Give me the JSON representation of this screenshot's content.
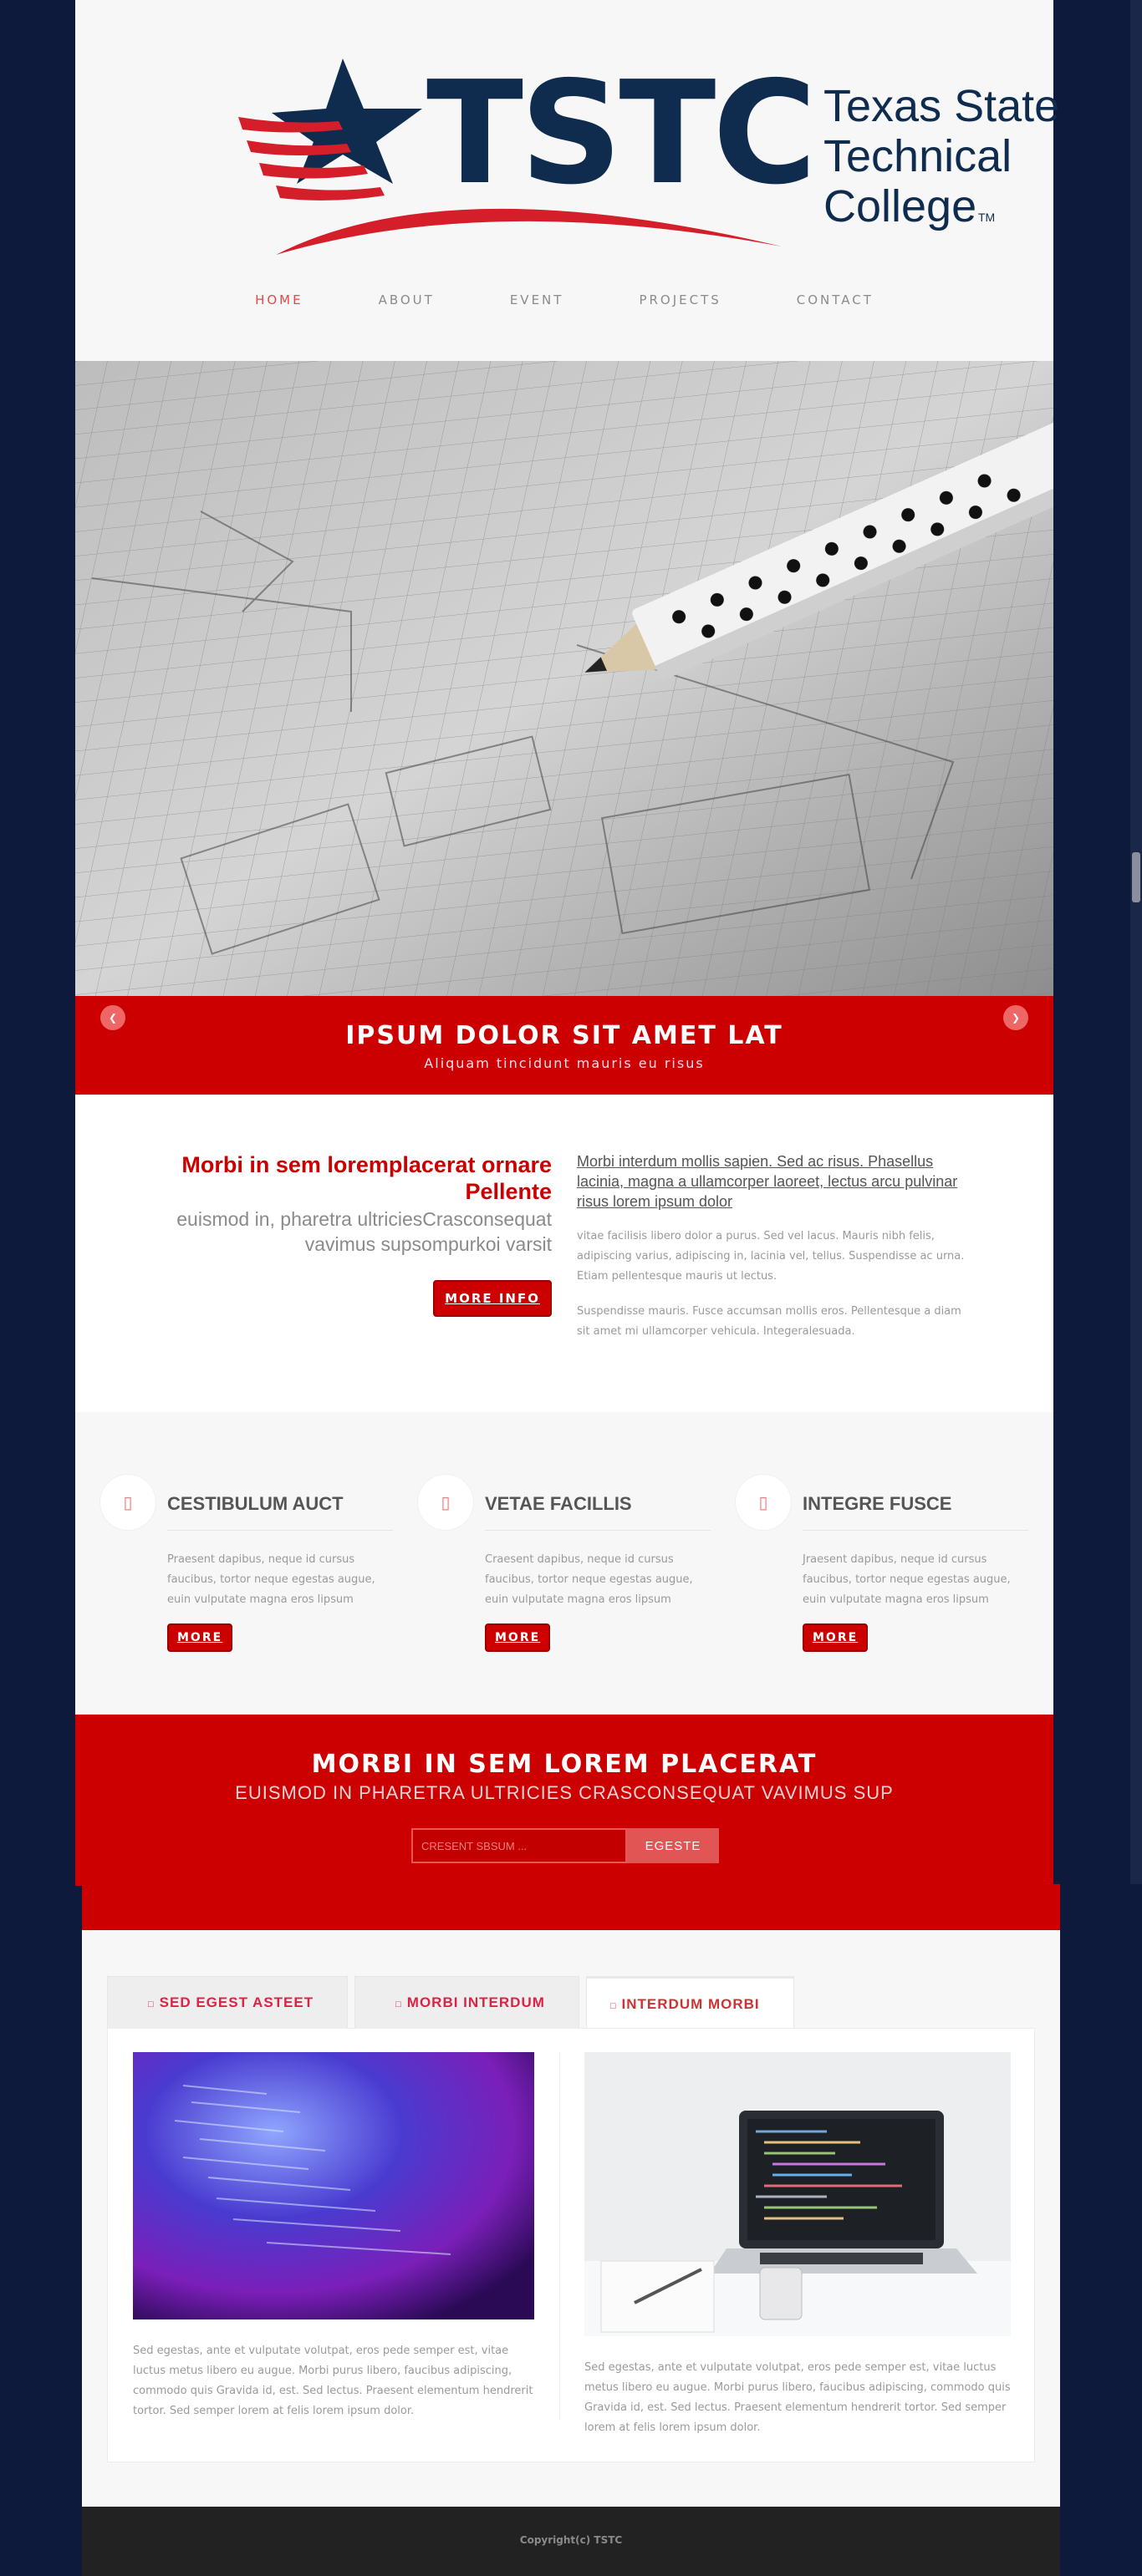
{
  "brand": {
    "logo_mark": "TSTC",
    "logo_text_1": "Texas State",
    "logo_text_2": "Technical",
    "logo_text_3": "College",
    "logo_tm": "TM"
  },
  "nav": {
    "items": [
      {
        "label": "HOME",
        "active": true
      },
      {
        "label": "ABOUT",
        "active": false
      },
      {
        "label": "EVENT",
        "active": false
      },
      {
        "label": "PROJECTS",
        "active": false
      },
      {
        "label": "CONTACT",
        "active": false
      }
    ]
  },
  "slider": {
    "title": "IPSUM DOLOR SIT AMET LAT",
    "subtitle": "Aliquam tincidunt mauris eu risus",
    "prev_icon": "chevron-left-icon",
    "next_icon": "chevron-right-icon"
  },
  "intro": {
    "heading": "Morbi in sem loremplacerat ornare Pellente",
    "subheading": "euismod in, pharetra ultriciesCrasconsequat vavimus supsompurkoi varsit",
    "button": "MORE INFO",
    "lead": "Morbi interdum mollis sapien. Sed ac risus. Phasellus lacinia, magna a ullamcorper laoreet, lectus arcu pulvinar risus lorem ipsum dolor",
    "para1": "vitae facilisis libero dolor a purus. Sed vel lacus. Mauris nibh felis, adipiscing varius, adipiscing in, lacinia vel, tellus. Suspendisse ac urna. Etiam pellentesque mauris ut lectus.",
    "para2": "Suspendisse mauris. Fusce accumsan mollis eros. Pellentesque a diam sit amet mi ullamcorper vehicula. Integeralesuada."
  },
  "features": [
    {
      "title": "CESTIBULUM AUCT",
      "text": "Praesent dapibus, neque id cursus faucibus, tortor neque egestas augue, euin vulputate magna eros lipsum",
      "button": "MORE",
      "icon": "mobile-icon"
    },
    {
      "title": "VETAE FACILLIS",
      "text": "Craesent dapibus, neque id cursus faucibus, tortor neque egestas augue, euin vulputate magna eros lipsum",
      "button": "MORE",
      "icon": "mobile-icon"
    },
    {
      "title": "INTEGRE FUSCE",
      "text": "Jraesent dapibus, neque id cursus faucibus, tortor neque egestas augue, euin vulputate magna eros lipsum",
      "button": "MORE",
      "icon": "mobile-icon"
    }
  ],
  "subscribe": {
    "title": "MORBI IN SEM LOREM PLACERAT",
    "subtitle": "EUISMOD IN PHARETRA ULTRICIES CRASCONSEQUAT VAVIMUS SUP",
    "placeholder": "CRESENT SBSUM ...",
    "button": "EGESTE"
  },
  "tabs": {
    "items": [
      {
        "label": "SED EGEST ASTEET",
        "active": false
      },
      {
        "label": "MORBI INTERDUM",
        "active": false
      },
      {
        "label": "INTERDUM MORBI",
        "active": true
      }
    ],
    "col1_text": "Sed egestas, ante et vulputate volutpat, eros pede semper est, vitae luctus metus libero eu augue. Morbi purus libero, faucibus adipiscing, commodo quis Gravida id, est. Sed lectus. Praesent elementum hendrerit tortor. Sed semper lorem at felis lorem ipsum dolor.",
    "col2_text": "Sed egestas, ante et vulputate volutpat, eros pede semper est, vitae luctus metus libero eu augue. Morbi purus libero, faucibus adipiscing, commodo quis Gravida id, est. Sed lectus. Praesent elementum hendrerit tortor. Sed semper lorem at felis lorem ipsum dolor."
  },
  "footer": {
    "copyright": "Copyright(c) TSTC"
  },
  "colors": {
    "brand_red": "#cc0000",
    "navy": "#0e1a3b",
    "logo_blue": "#0f2c4f",
    "nav_active": "#e24a47"
  }
}
